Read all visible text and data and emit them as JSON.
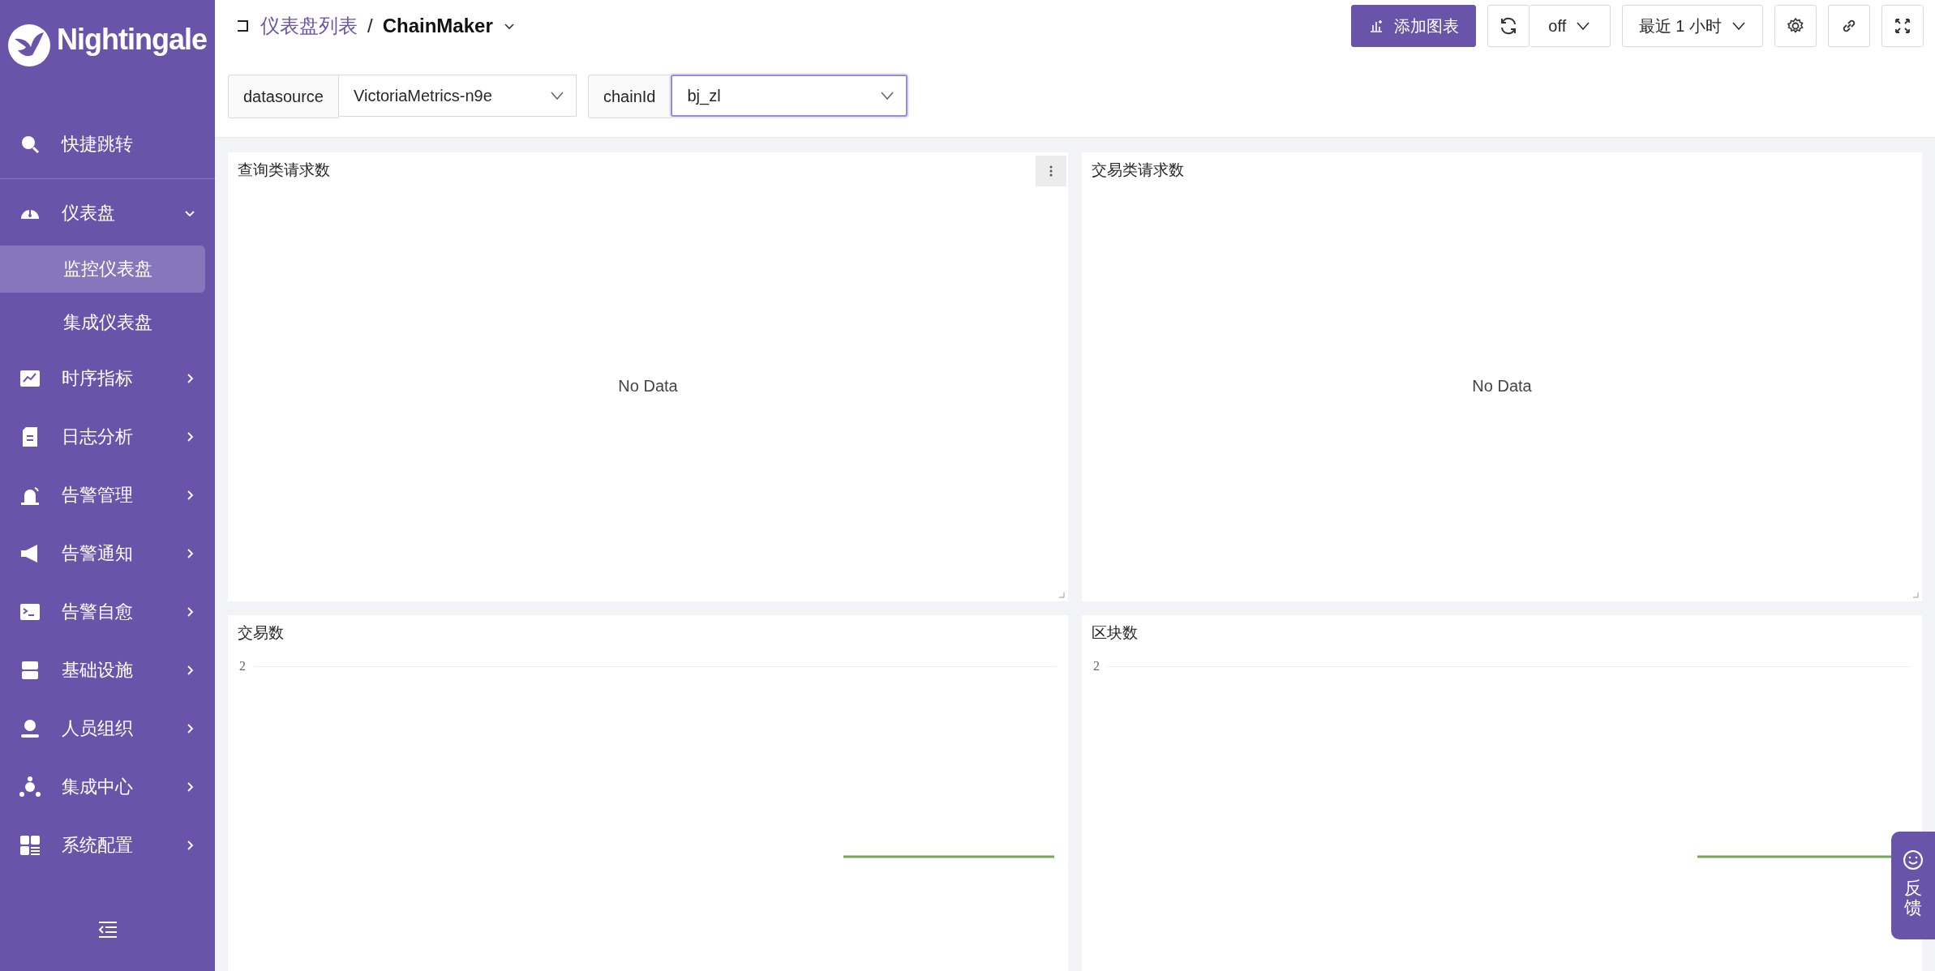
{
  "sidebar": {
    "logo": "Nightingale",
    "items": [
      {
        "kind": "link",
        "label": "快捷跳转"
      },
      {
        "kind": "group",
        "label": "仪表盘",
        "expanded": true,
        "children": [
          {
            "label": "监控仪表盘",
            "selected": true
          },
          {
            "label": "集成仪表盘",
            "selected": false
          }
        ]
      },
      {
        "kind": "group",
        "label": "时序指标",
        "expanded": false
      },
      {
        "kind": "group",
        "label": "日志分析",
        "expanded": false
      },
      {
        "kind": "group",
        "label": "告警管理",
        "expanded": false
      },
      {
        "kind": "group",
        "label": "告警通知",
        "expanded": false
      },
      {
        "kind": "group",
        "label": "告警自愈",
        "expanded": false
      },
      {
        "kind": "group",
        "label": "基础设施",
        "expanded": false
      },
      {
        "kind": "group",
        "label": "人员组织",
        "expanded": false
      },
      {
        "kind": "group",
        "label": "集成中心",
        "expanded": false
      },
      {
        "kind": "group",
        "label": "系统配置",
        "expanded": false
      }
    ]
  },
  "breadcrumb": {
    "parent": "仪表盘列表",
    "separator": "/",
    "current": "ChainMaker"
  },
  "toolbar": {
    "add_button": "添加图表",
    "refresh": "off",
    "time_range": "最近 1 小时"
  },
  "variables": [
    {
      "label": "datasource",
      "value": "VictoriaMetrics-n9e",
      "focused": false
    },
    {
      "label": "chainId",
      "value": "bj_zl",
      "focused": true
    }
  ],
  "panels": [
    {
      "kind": "empty",
      "title": "查询类请求数",
      "message": "No Data",
      "menu": true
    },
    {
      "kind": "empty",
      "title": "交易类请求数",
      "message": "No Data",
      "menu": false
    },
    {
      "kind": "timeseries",
      "title": "交易数",
      "y_tick": "2"
    },
    {
      "kind": "timeseries",
      "title": "区块数",
      "y_tick": "2"
    }
  ],
  "feedback": "反馈"
}
